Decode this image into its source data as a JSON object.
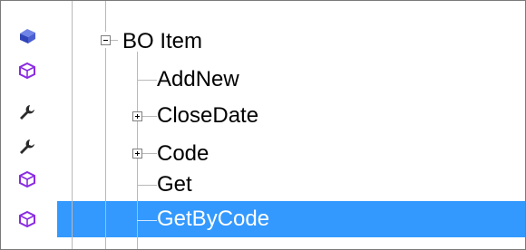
{
  "tree": {
    "root": {
      "label": "BO  Item",
      "expanded": true
    },
    "children": [
      {
        "label": "AddNew",
        "has_children": false,
        "selected": false
      },
      {
        "label": "CloseDate",
        "has_children": true,
        "selected": false
      },
      {
        "label": "Code",
        "has_children": true,
        "selected": false
      },
      {
        "label": "Get",
        "has_children": false,
        "selected": false
      },
      {
        "label": "GetByCode",
        "has_children": false,
        "selected": true
      }
    ]
  },
  "gutter_icons": [
    {
      "icon": "business-object-icon",
      "color": "#3b4fc8"
    },
    {
      "icon": "method-cube-icon",
      "color": "#8a2be2"
    },
    {
      "icon": "property-wrench-icon",
      "color": "#2b2b2b"
    },
    {
      "icon": "property-wrench-icon",
      "color": "#2b2b2b"
    },
    {
      "icon": "method-cube-icon",
      "color": "#8a2be2"
    },
    {
      "icon": "method-cube-icon",
      "color": "#8a2be2"
    }
  ],
  "colors": {
    "selection": "#3399ff",
    "selection_text": "#ffffff",
    "tree_line": "#b9b9b9"
  }
}
